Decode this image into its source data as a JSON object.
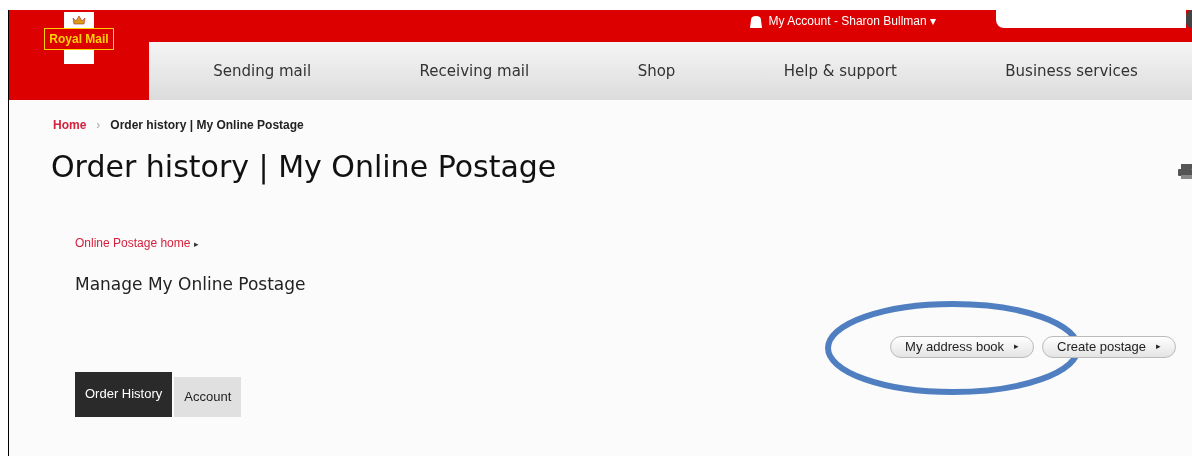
{
  "header": {
    "logo": "Royal Mail",
    "account": "My Account - Sharon Bullman",
    "account_caret": "▾"
  },
  "nav": [
    {
      "label": "Sending mail"
    },
    {
      "label": "Receiving mail"
    },
    {
      "label": "Shop"
    },
    {
      "label": "Help & support"
    },
    {
      "label": "Business services"
    }
  ],
  "breadcrumb": [
    {
      "label": "Home",
      "kind": "link"
    },
    {
      "label": "›",
      "kind": "separator"
    },
    {
      "label": "Order history | My Online Postage",
      "kind": "current"
    }
  ],
  "title": "Order history | My Online Postage",
  "section_link": {
    "label": "Online Postage home",
    "arrow": "▸"
  },
  "heading": "Manage My Online Postage",
  "actions": [
    {
      "label": "My address book",
      "arrow": "▸",
      "highlighted": true
    },
    {
      "label": "Create postage",
      "arrow": "▸",
      "highlighted": false
    }
  ],
  "tabs": [
    {
      "label": "Order History",
      "selected": true
    },
    {
      "label": "Account",
      "selected": false
    }
  ]
}
